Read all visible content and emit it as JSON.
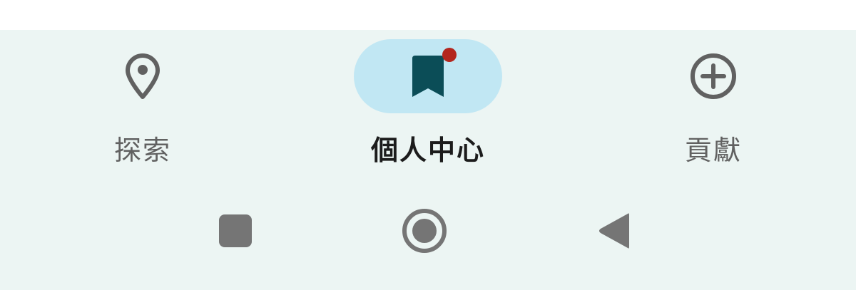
{
  "nav": {
    "items": [
      {
        "label": "探索",
        "icon": "location-pin-icon",
        "active": false
      },
      {
        "label": "個人中心",
        "icon": "bookmark-icon",
        "active": true,
        "badge": true
      },
      {
        "label": "貢獻",
        "icon": "add-circle-icon",
        "active": false
      }
    ]
  },
  "system_nav": {
    "buttons": [
      "recents-square-icon",
      "home-circle-icon",
      "back-triangle-icon"
    ]
  },
  "colors": {
    "background": "#ecf5f3",
    "active_pill": "#c1e7f3",
    "bookmark": "#0b4d57",
    "badge": "#b3261e",
    "icon_gray": "#616161"
  }
}
